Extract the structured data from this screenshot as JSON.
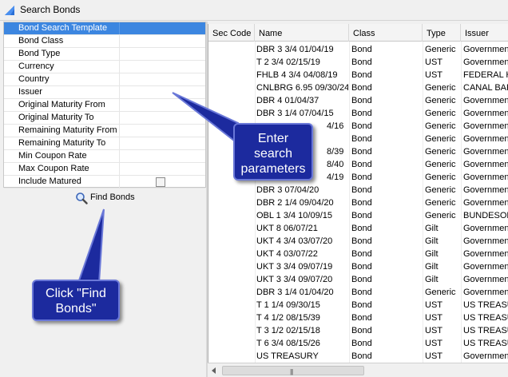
{
  "window": {
    "title": "Search Bonds"
  },
  "criteria": {
    "items": [
      {
        "label": "Bond Search Template",
        "selected": true
      },
      {
        "label": "Bond Class"
      },
      {
        "label": "Bond Type"
      },
      {
        "label": "Currency"
      },
      {
        "label": "Country"
      },
      {
        "label": "Issuer"
      },
      {
        "label": "Original Maturity From"
      },
      {
        "label": "Original Maturity To"
      },
      {
        "label": "Remaining Maturity From"
      },
      {
        "label": "Remaining Maturity To"
      },
      {
        "label": "Min Coupon Rate"
      },
      {
        "label": "Max Coupon Rate"
      },
      {
        "label": "Include Matured",
        "checkbox": true,
        "checked": false
      }
    ]
  },
  "find_button": {
    "label": "Find Bonds",
    "icon": "magnifier-icon"
  },
  "grid": {
    "columns": [
      "Sec Code",
      "Name",
      "Class",
      "Type",
      "Issuer"
    ],
    "rows": [
      [
        "",
        "DBR 3 3/4 01/04/19",
        "Bond",
        "Generic",
        "Government"
      ],
      [
        "",
        "T 2 3/4 02/15/19",
        "Bond",
        "UST",
        "Government"
      ],
      [
        "",
        "FHLB 4 3/4 04/08/19",
        "Bond",
        "UST",
        "FEDERAL HO"
      ],
      [
        "",
        "CNLBRG 6.95 09/30/24",
        "Bond",
        "Generic",
        "CANAL BAR"
      ],
      [
        "",
        "DBR 4 01/04/37",
        "Bond",
        "Generic",
        "Government"
      ],
      [
        "",
        "DBR 3 1/4 07/04/15",
        "Bond",
        "Generic",
        "Government"
      ],
      [
        "",
        "",
        "Bond",
        "Generic",
        "Government"
      ],
      [
        "",
        "",
        "Bond",
        "Generic",
        "Government"
      ],
      [
        "",
        "",
        "Bond",
        "Generic",
        "Government"
      ],
      [
        "",
        "",
        "Bond",
        "Generic",
        "Government"
      ],
      [
        "",
        "",
        "Bond",
        "Generic",
        "Government"
      ],
      [
        "",
        "DBR 3 07/04/20",
        "Bond",
        "Generic",
        "Government"
      ],
      [
        "",
        "DBR 2 1/4 09/04/20",
        "Bond",
        "Generic",
        "Government"
      ],
      [
        "",
        "OBL 1 3/4 10/09/15",
        "Bond",
        "Generic",
        "BUNDESOBL"
      ],
      [
        "",
        "UKT 8 06/07/21",
        "Bond",
        "Gilt",
        "Government"
      ],
      [
        "",
        "UKT 4 3/4 03/07/20",
        "Bond",
        "Gilt",
        "Government"
      ],
      [
        "",
        "UKT 4 03/07/22",
        "Bond",
        "Gilt",
        "Government"
      ],
      [
        "",
        "UKT 3 3/4 09/07/19",
        "Bond",
        "Gilt",
        "Government"
      ],
      [
        "",
        "UKT 3 3/4 09/07/20",
        "Bond",
        "Gilt",
        "Government"
      ],
      [
        "",
        "DBR 3 1/4 01/04/20",
        "Bond",
        "Generic",
        "Government"
      ],
      [
        "",
        "T 1 1/4 09/30/15",
        "Bond",
        "UST",
        "US TREASUR"
      ],
      [
        "",
        "T 4 1/2 08/15/39",
        "Bond",
        "UST",
        "US TREASUR"
      ],
      [
        "",
        "T 3 1/2 02/15/18",
        "Bond",
        "UST",
        "US TREASUR"
      ],
      [
        "",
        "T 6 3/4 08/15/26",
        "Bond",
        "UST",
        "US TREASUR"
      ],
      [
        "",
        "US TREASURY",
        "Bond",
        "UST",
        "Government"
      ]
    ],
    "partial_names": [
      {
        "row": 6,
        "text": "4/16"
      },
      {
        "row": 8,
        "text": "8/39"
      },
      {
        "row": 9,
        "text": "8/40"
      },
      {
        "row": 10,
        "text": "4/19"
      }
    ]
  },
  "callouts": {
    "enter": {
      "lines": [
        "Enter",
        "search",
        "parameters"
      ]
    },
    "click": {
      "lines": [
        "Click \"Find",
        "Bonds\""
      ]
    }
  },
  "colors": {
    "selection": "#3c86e0",
    "callout": "#1c2a9e",
    "callout_border": "#6a78d8"
  }
}
